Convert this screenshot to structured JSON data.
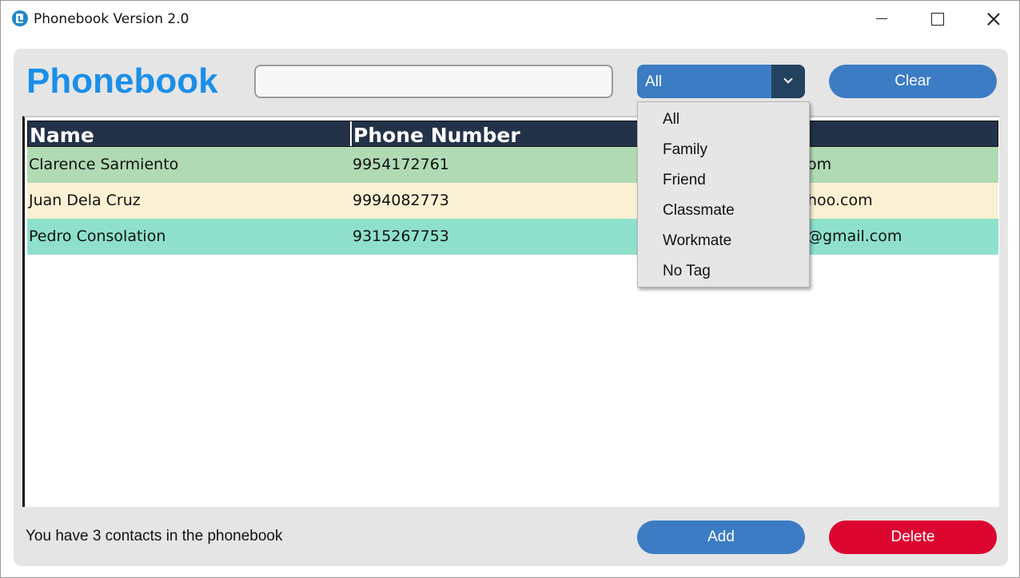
{
  "window": {
    "title": "Phonebook Version 2.0",
    "controls": [
      "minimize-icon",
      "maximize-icon",
      "close-icon"
    ]
  },
  "header": {
    "heading": "Phonebook",
    "search": {
      "value": "",
      "placeholder": ""
    },
    "filter": {
      "selected": "All",
      "options": [
        "All",
        "Family",
        "Friend",
        "Classmate",
        "Workmate",
        "No Tag"
      ],
      "expanded": true
    },
    "clear_label": "Clear"
  },
  "table": {
    "columns": [
      "Name",
      "Phone Number",
      ""
    ],
    "rows": [
      {
        "name": "Clarence Sarmiento",
        "phone": "9954172761",
        "email_visible": "om",
        "color": "#b0dab3"
      },
      {
        "name": "Juan Dela Cruz",
        "phone": "9994082773",
        "email_visible": "hoo.com",
        "color": "#faf0d3"
      },
      {
        "name": "Pedro Consolation",
        "phone": "9315267753",
        "email_visible": "@gmail.com",
        "color": "#8ee0cc"
      }
    ]
  },
  "footer": {
    "status": "You have 3 contacts in the phonebook",
    "add_label": "Add",
    "delete_label": "Delete"
  },
  "colors": {
    "heading": "#1a8fe8",
    "accent": "#3b7cc4",
    "danger": "#dc0530",
    "table_header": "#233248",
    "panel": "#e5e5e5"
  }
}
